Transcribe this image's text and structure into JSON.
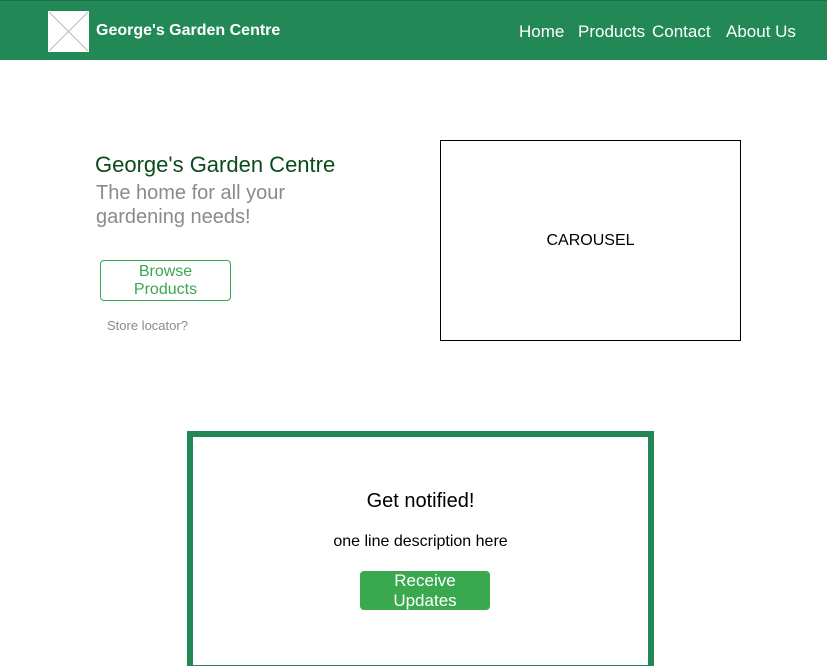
{
  "header": {
    "brand": "George's Garden Centre",
    "logo_icon": "image-placeholder-icon",
    "nav": [
      {
        "label": "Home"
      },
      {
        "label": "Products"
      },
      {
        "label": "Contact"
      },
      {
        "label": "About Us"
      }
    ]
  },
  "hero": {
    "title": "George's Garden Centre",
    "subtitle": "The home for all your gardening needs!",
    "browse_label": "Browse Products",
    "store_locator": "Store locator?",
    "carousel_label": "CAROUSEL"
  },
  "notify": {
    "title": "Get notified!",
    "description": "one line description here",
    "button_label": "Receive Updates"
  },
  "colors": {
    "brand_green": "#218856",
    "button_green": "#39a84e",
    "title_green": "#0c4a1c",
    "muted_gray": "#8a8a8a"
  }
}
